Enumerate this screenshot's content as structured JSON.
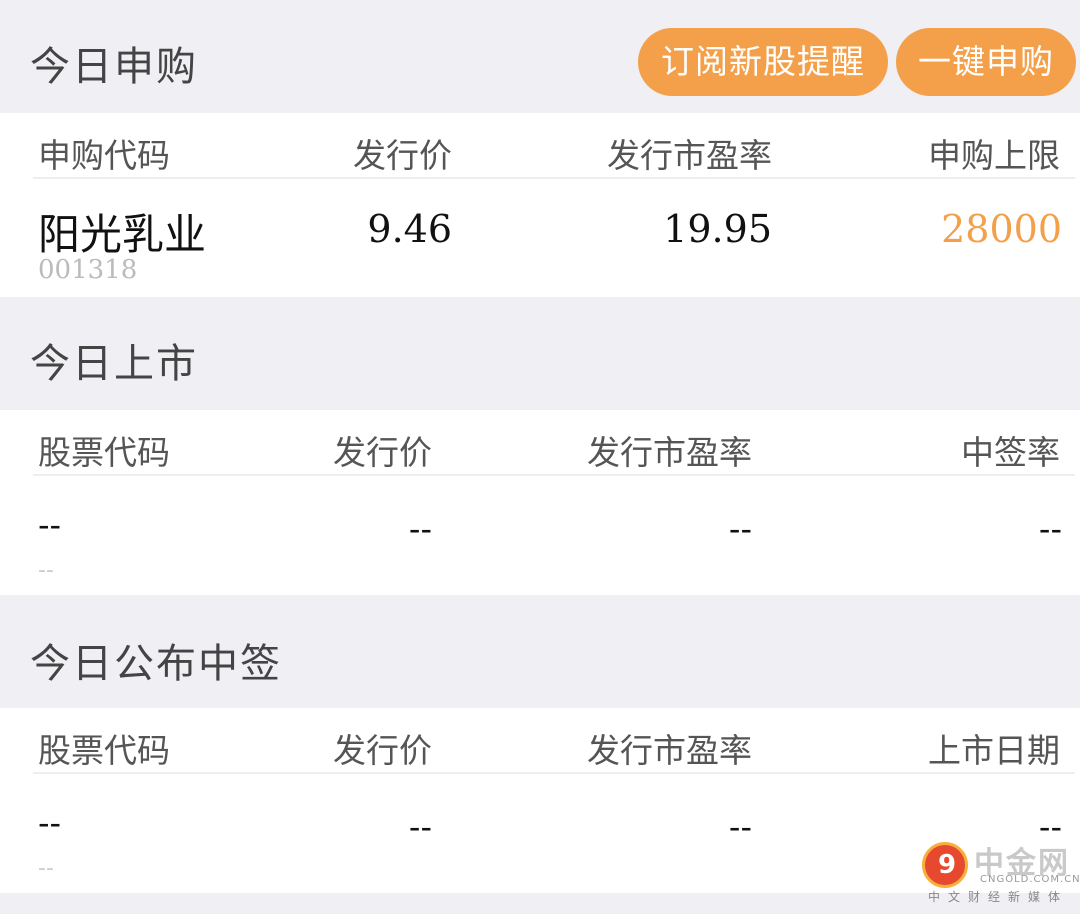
{
  "subscribe": {
    "title": "今日申购",
    "buttons": {
      "subscribe_alert": "订阅新股提醒",
      "one_click": "一键申购"
    },
    "headers": [
      "申购代码",
      "发行价",
      "发行市盈率",
      "申购上限"
    ],
    "row": {
      "name": "阳光乳业",
      "code": "001318",
      "price": "9.46",
      "pe": "19.95",
      "limit": "28000"
    }
  },
  "listing": {
    "title": "今日上市",
    "headers": [
      "股票代码",
      "发行价",
      "发行市盈率",
      "中签率"
    ],
    "row": {
      "name": "--",
      "code": "--",
      "price": "--",
      "pe": "--",
      "rate": "--"
    }
  },
  "lottery": {
    "title": "今日公布中签",
    "headers": [
      "股票代码",
      "发行价",
      "发行市盈率",
      "上市日期"
    ],
    "row": {
      "name": "--",
      "code": "--",
      "price": "--",
      "pe": "--",
      "date": "--"
    }
  },
  "watermark": {
    "glyph": "9",
    "title": "中金网",
    "url": "CNGOLD.COM.CN",
    "sub": "中文财经新媒体"
  },
  "colors": {
    "accent": "#f4a04a",
    "background": "#efeff4"
  }
}
